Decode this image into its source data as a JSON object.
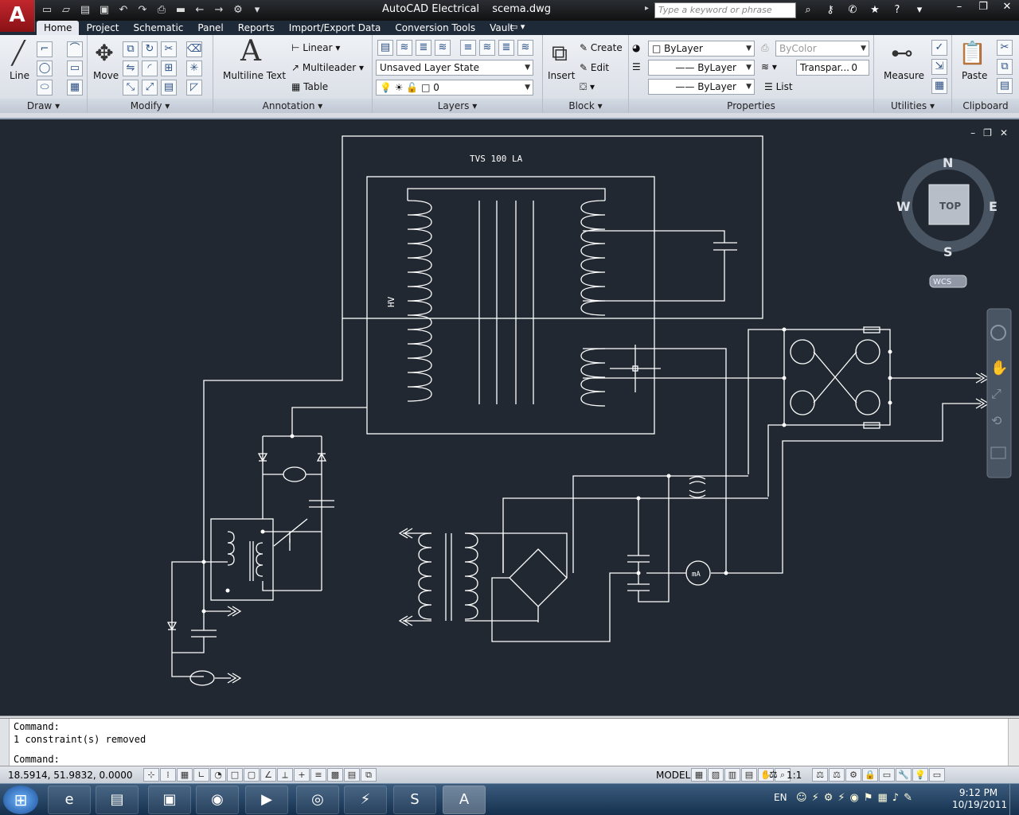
{
  "app": {
    "logo_letter": "A",
    "app_name": "AutoCAD Electrical",
    "file_name": "scema.dwg",
    "search_placeholder": "Type a keyword or phrase"
  },
  "tabs": [
    {
      "label": "Home"
    },
    {
      "label": "Project"
    },
    {
      "label": "Schematic"
    },
    {
      "label": "Panel"
    },
    {
      "label": "Reports"
    },
    {
      "label": "Import/Export Data"
    },
    {
      "label": "Conversion Tools"
    },
    {
      "label": "Vault"
    }
  ],
  "ribbon": {
    "draw": {
      "title": "Draw",
      "line": "Line"
    },
    "modify": {
      "title": "Modify",
      "move": "Move"
    },
    "annotation": {
      "title": "Annotation",
      "mtext": "Multiline Text",
      "linear": "Linear",
      "multileader": "Multileader",
      "table": "Table"
    },
    "layers": {
      "title": "Layers",
      "layer_state": "Unsaved Layer State",
      "current_layer": "0"
    },
    "block": {
      "title": "Block",
      "insert": "Insert",
      "create": "Create",
      "edit": "Edit"
    },
    "properties": {
      "title": "Properties",
      "color": "ByLayer",
      "plot_style": "ByColor",
      "linetype": "ByLayer",
      "lineweight": "ByLayer",
      "transparency": "Transpar...",
      "transparency_value": "0",
      "list": "List"
    },
    "utilities": {
      "title": "Utilities",
      "measure": "Measure"
    },
    "clipboard": {
      "title": "Clipboard",
      "paste": "Paste"
    }
  },
  "drawing": {
    "title_text": "TVS 100 LA",
    "hv_label": "HV",
    "meter_label": "mA",
    "viewcube": {
      "north": "N",
      "south": "S",
      "east": "E",
      "west": "W",
      "face": "TOP",
      "ucs": "WCS"
    }
  },
  "command": {
    "history": [
      "Command:",
      "1 constraint(s) removed"
    ],
    "prompt": "Command:"
  },
  "status": {
    "coordinates": "18.5914, 51.9832, 0.0000",
    "model": "MODEL",
    "annotation_scale": "1:1"
  },
  "taskbar": {
    "language": "EN",
    "time": "9:12 PM",
    "date": "10/19/2011"
  }
}
